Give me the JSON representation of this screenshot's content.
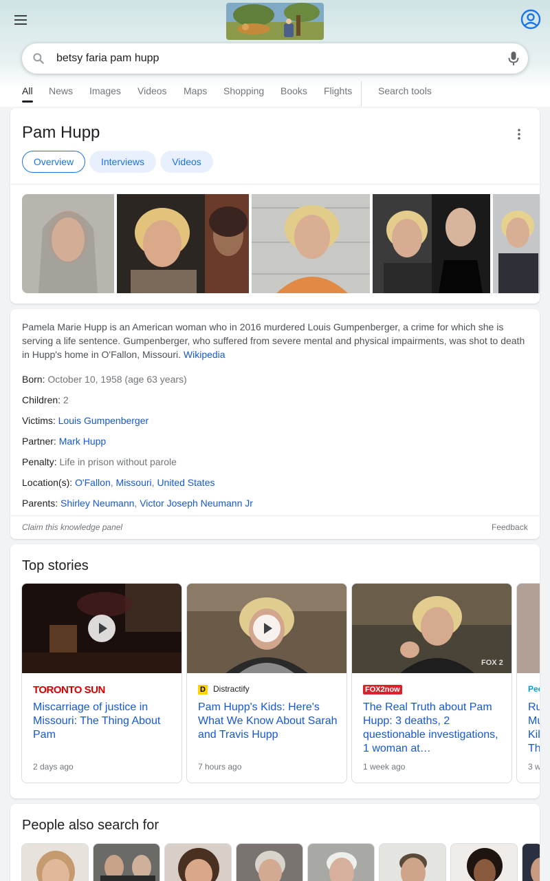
{
  "search": {
    "query": "betsy faria pam hupp",
    "tabs": [
      "All",
      "News",
      "Images",
      "Videos",
      "Maps",
      "Shopping",
      "Books",
      "Flights"
    ],
    "tools_label": "Search tools"
  },
  "knowledge_panel": {
    "title": "Pam Hupp",
    "chips": [
      "Overview",
      "Interviews",
      "Videos"
    ],
    "description": "Pamela Marie Hupp is an American woman who in 2016 murdered Louis Gumpenberger, a crime for which she is serving a life sentence. Gumpenberger, who suffered from severe mental and physical impairments, was shot to death in Hupp's home in O'Fallon, Missouri.",
    "source_link": "Wikipedia",
    "facts": {
      "born_label": "Born:",
      "born_value": "October 10, 1958 (age 63 years)",
      "children_label": "Children:",
      "children_value": "2",
      "victims_label": "Victims:",
      "victims_value": "Louis Gumpenberger",
      "partner_label": "Partner:",
      "partner_value": "Mark Hupp",
      "penalty_label": "Penalty:",
      "penalty_value": "Life in prison without parole",
      "location_label": "Location(s):",
      "location_1": "O'Fallon",
      "location_2": "Missouri",
      "location_3": "United States",
      "parents_label": "Parents:",
      "parent_1": "Shirley Neumann",
      "parent_2": "Victor Joseph Neumann Jr"
    },
    "claim_label": "Claim this knowledge panel",
    "feedback_label": "Feedback"
  },
  "top_stories": {
    "title": "Top stories",
    "items": [
      {
        "source": "TORONTO SUN",
        "headline": "Miscarriage of justice in Missouri: The Thing About Pam",
        "time": "2 days ago"
      },
      {
        "source": "Distractify",
        "headline": "Pam Hupp's Kids: Here's What We Know About Sarah and Travis Hupp",
        "time": "7 hours ago"
      },
      {
        "source": "FOX2now",
        "headline": "The Real Truth about Pam Hupp: 3 deaths, 2 questionable investigations, 1 woman at…",
        "time": "1 week ago"
      },
      {
        "source": "People",
        "headline": "Ru Mu Kil Th",
        "time": "3 w"
      }
    ]
  },
  "people_also_search": {
    "title": "People also search for"
  },
  "colors": {
    "link": "#1558d6",
    "chip_bg": "#e8f0fe",
    "toronto_sun_red": "#d50000",
    "fox_red": "#d8232a"
  }
}
